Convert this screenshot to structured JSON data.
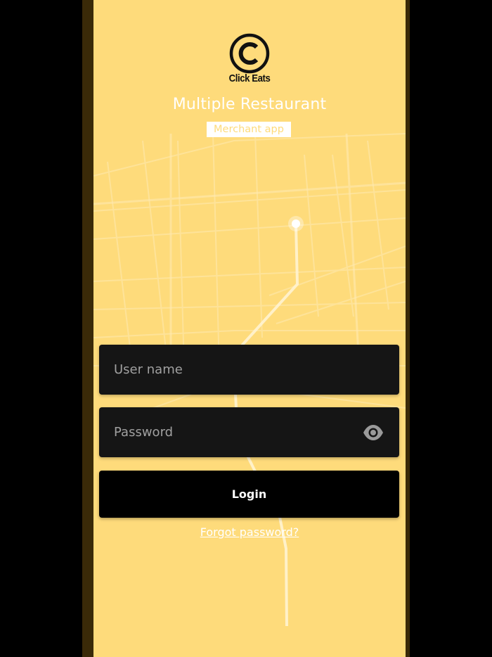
{
  "brand": {
    "logo_icon": "click-eats-logo-icon",
    "name": "Click Eats"
  },
  "header": {
    "title": "Multiple Restaurant",
    "subtitle": "Merchant app"
  },
  "form": {
    "username": {
      "placeholder": "User name",
      "value": ""
    },
    "password": {
      "placeholder": "Password",
      "value": "",
      "toggle_icon": "eye-icon"
    },
    "login_label": "Login",
    "forgot_label": "Forgot password?"
  },
  "colors": {
    "background": "#fedb7b",
    "field": "#151515",
    "button": "#000000",
    "text_light": "#ffffff"
  }
}
